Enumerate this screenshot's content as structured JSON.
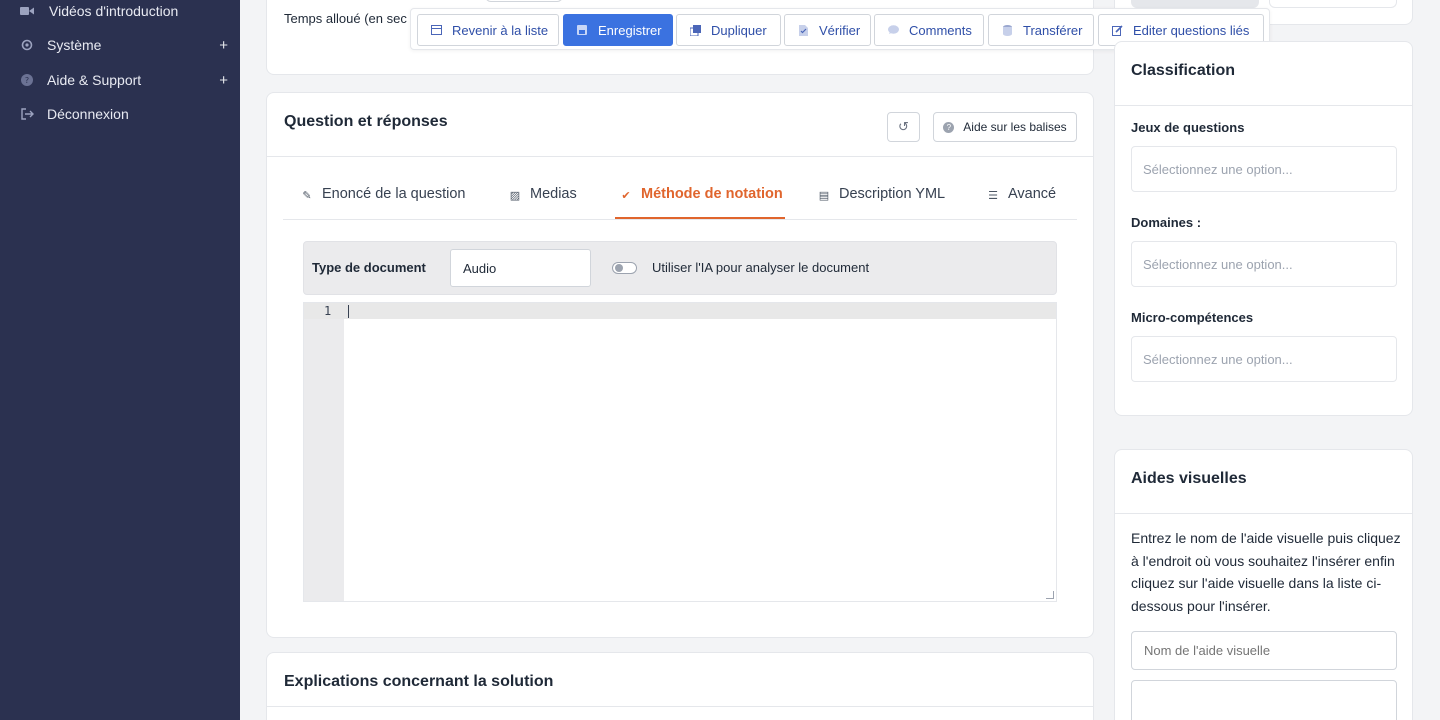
{
  "sidebar": {
    "items": [
      {
        "label": "Vidéos d'introduction",
        "icon": "video-icon"
      },
      {
        "label": "Système",
        "icon": "gear-icon",
        "expand": "+"
      },
      {
        "label": "Aide & Support",
        "icon": "help-icon",
        "expand": "+"
      },
      {
        "label": "Déconnexion",
        "icon": "logout-icon"
      }
    ]
  },
  "top_card": {
    "time_label": "Temps alloué (en sec"
  },
  "toolbar": {
    "back": "Revenir à la liste",
    "save": "Enregistrer",
    "duplicate": "Dupliquer",
    "verify": "Vérifier",
    "comments": "Comments",
    "transfer": "Transférer",
    "edit_linked": "Editer questions liés"
  },
  "qa_card": {
    "title": "Question et réponses",
    "history_glyph": "↺",
    "help_tags": "Aide sur les balises",
    "tabs": [
      {
        "label": "Enoncé de la question",
        "icon": "edit-icon",
        "glyph": "✎"
      },
      {
        "label": "Medias",
        "icon": "image-icon",
        "glyph": "▨"
      },
      {
        "label": "Méthode de notation",
        "icon": "shield-check-icon",
        "glyph": "✔"
      },
      {
        "label": "Description YML",
        "icon": "code-file-icon",
        "glyph": "▤"
      },
      {
        "label": "Avancé",
        "icon": "sliders-icon",
        "glyph": "☰"
      }
    ],
    "active_tab": 2,
    "doc_type_label": "Type de document",
    "doc_type_value": "Audio",
    "ai_toggle_label": "Utiliser l'IA pour analyser le document",
    "ai_toggle_on": false,
    "editor_line_number": "1"
  },
  "explanations_card": {
    "title": "Explications concernant la solution"
  },
  "classification": {
    "title": "Classification",
    "question_sets_label": "Jeux de questions",
    "question_sets_placeholder": "Sélectionnez une option...",
    "domains_label": "Domaines :",
    "domains_placeholder": "Sélectionnez une option...",
    "micro_skills_label": "Micro-compétences",
    "micro_skills_placeholder": "Sélectionnez une option..."
  },
  "visual_aids": {
    "title": "Aides visuelles",
    "instructions": "Entrez le nom de l'aide visuelle puis cliquez à l'endroit où vous souhaitez l'insérer enfin cliquez sur l'aide visuelle dans la liste ci-dessous pour l'insérer.",
    "name_placeholder": "Nom de l'aide visuelle"
  },
  "colors": {
    "sidebar_bg": "#2b3150",
    "primary": "#3b72e0",
    "active_tab": "#e0652d"
  }
}
